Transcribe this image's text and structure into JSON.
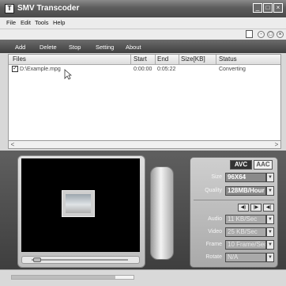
{
  "window": {
    "title": "SMV Transcoder",
    "app_icon_glyph": "T"
  },
  "window_controls": {
    "minimize": "_",
    "maximize": "□",
    "close": "×"
  },
  "menu": [
    "File",
    "Edit",
    "Tools",
    "Help"
  ],
  "mdi_controls": {
    "minimize": "-",
    "restore": "□",
    "close": "×"
  },
  "toolbar": [
    "Add",
    "Delete",
    "Stop",
    "Setting",
    "About"
  ],
  "file_list": {
    "columns": [
      "Files",
      "Start",
      "End",
      "Size[KB]",
      "Status"
    ],
    "rows": [
      {
        "checked": true,
        "file": "D:\\Example.mpg",
        "start": "0:00:00",
        "end": "0:05:22",
        "size": "",
        "status": "Converting"
      }
    ]
  },
  "scroll_arrows": {
    "left": "<",
    "right": ">"
  },
  "settings": {
    "badges": [
      "AVC",
      "AAC"
    ],
    "size_label": "Size",
    "size_value": "96X64",
    "quality_label": "Quality",
    "quality_value": "128MB/Hour",
    "audio_label": "Audio",
    "audio_value": "11 KB/Sec",
    "video_label": "Video",
    "video_value": "25 KB/Sec",
    "frame_label": "Frame",
    "frame_value": "10 Frame/Sec",
    "rotate_label": "Rotate",
    "rotate_value": "N/A",
    "dropdown_glyph": "▼",
    "button_glyphs": [
      "◀)",
      "|▶",
      "◀|"
    ]
  },
  "progress": {
    "fraction": 0.85
  }
}
